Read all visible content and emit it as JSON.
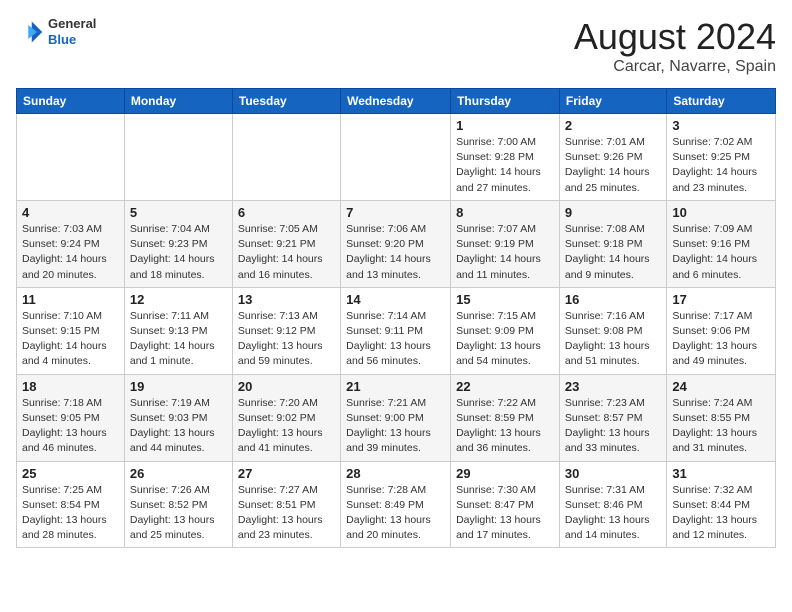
{
  "header": {
    "logo_line1": "General",
    "logo_line2": "Blue",
    "month_year": "August 2024",
    "location": "Carcar, Navarre, Spain"
  },
  "weekdays": [
    "Sunday",
    "Monday",
    "Tuesday",
    "Wednesday",
    "Thursday",
    "Friday",
    "Saturday"
  ],
  "weeks": [
    [
      {
        "day": "",
        "detail": ""
      },
      {
        "day": "",
        "detail": ""
      },
      {
        "day": "",
        "detail": ""
      },
      {
        "day": "",
        "detail": ""
      },
      {
        "day": "1",
        "detail": "Sunrise: 7:00 AM\nSunset: 9:28 PM\nDaylight: 14 hours\nand 27 minutes."
      },
      {
        "day": "2",
        "detail": "Sunrise: 7:01 AM\nSunset: 9:26 PM\nDaylight: 14 hours\nand 25 minutes."
      },
      {
        "day": "3",
        "detail": "Sunrise: 7:02 AM\nSunset: 9:25 PM\nDaylight: 14 hours\nand 23 minutes."
      }
    ],
    [
      {
        "day": "4",
        "detail": "Sunrise: 7:03 AM\nSunset: 9:24 PM\nDaylight: 14 hours\nand 20 minutes."
      },
      {
        "day": "5",
        "detail": "Sunrise: 7:04 AM\nSunset: 9:23 PM\nDaylight: 14 hours\nand 18 minutes."
      },
      {
        "day": "6",
        "detail": "Sunrise: 7:05 AM\nSunset: 9:21 PM\nDaylight: 14 hours\nand 16 minutes."
      },
      {
        "day": "7",
        "detail": "Sunrise: 7:06 AM\nSunset: 9:20 PM\nDaylight: 14 hours\nand 13 minutes."
      },
      {
        "day": "8",
        "detail": "Sunrise: 7:07 AM\nSunset: 9:19 PM\nDaylight: 14 hours\nand 11 minutes."
      },
      {
        "day": "9",
        "detail": "Sunrise: 7:08 AM\nSunset: 9:18 PM\nDaylight: 14 hours\nand 9 minutes."
      },
      {
        "day": "10",
        "detail": "Sunrise: 7:09 AM\nSunset: 9:16 PM\nDaylight: 14 hours\nand 6 minutes."
      }
    ],
    [
      {
        "day": "11",
        "detail": "Sunrise: 7:10 AM\nSunset: 9:15 PM\nDaylight: 14 hours\nand 4 minutes."
      },
      {
        "day": "12",
        "detail": "Sunrise: 7:11 AM\nSunset: 9:13 PM\nDaylight: 14 hours\nand 1 minute."
      },
      {
        "day": "13",
        "detail": "Sunrise: 7:13 AM\nSunset: 9:12 PM\nDaylight: 13 hours\nand 59 minutes."
      },
      {
        "day": "14",
        "detail": "Sunrise: 7:14 AM\nSunset: 9:11 PM\nDaylight: 13 hours\nand 56 minutes."
      },
      {
        "day": "15",
        "detail": "Sunrise: 7:15 AM\nSunset: 9:09 PM\nDaylight: 13 hours\nand 54 minutes."
      },
      {
        "day": "16",
        "detail": "Sunrise: 7:16 AM\nSunset: 9:08 PM\nDaylight: 13 hours\nand 51 minutes."
      },
      {
        "day": "17",
        "detail": "Sunrise: 7:17 AM\nSunset: 9:06 PM\nDaylight: 13 hours\nand 49 minutes."
      }
    ],
    [
      {
        "day": "18",
        "detail": "Sunrise: 7:18 AM\nSunset: 9:05 PM\nDaylight: 13 hours\nand 46 minutes."
      },
      {
        "day": "19",
        "detail": "Sunrise: 7:19 AM\nSunset: 9:03 PM\nDaylight: 13 hours\nand 44 minutes."
      },
      {
        "day": "20",
        "detail": "Sunrise: 7:20 AM\nSunset: 9:02 PM\nDaylight: 13 hours\nand 41 minutes."
      },
      {
        "day": "21",
        "detail": "Sunrise: 7:21 AM\nSunset: 9:00 PM\nDaylight: 13 hours\nand 39 minutes."
      },
      {
        "day": "22",
        "detail": "Sunrise: 7:22 AM\nSunset: 8:59 PM\nDaylight: 13 hours\nand 36 minutes."
      },
      {
        "day": "23",
        "detail": "Sunrise: 7:23 AM\nSunset: 8:57 PM\nDaylight: 13 hours\nand 33 minutes."
      },
      {
        "day": "24",
        "detail": "Sunrise: 7:24 AM\nSunset: 8:55 PM\nDaylight: 13 hours\nand 31 minutes."
      }
    ],
    [
      {
        "day": "25",
        "detail": "Sunrise: 7:25 AM\nSunset: 8:54 PM\nDaylight: 13 hours\nand 28 minutes."
      },
      {
        "day": "26",
        "detail": "Sunrise: 7:26 AM\nSunset: 8:52 PM\nDaylight: 13 hours\nand 25 minutes."
      },
      {
        "day": "27",
        "detail": "Sunrise: 7:27 AM\nSunset: 8:51 PM\nDaylight: 13 hours\nand 23 minutes."
      },
      {
        "day": "28",
        "detail": "Sunrise: 7:28 AM\nSunset: 8:49 PM\nDaylight: 13 hours\nand 20 minutes."
      },
      {
        "day": "29",
        "detail": "Sunrise: 7:30 AM\nSunset: 8:47 PM\nDaylight: 13 hours\nand 17 minutes."
      },
      {
        "day": "30",
        "detail": "Sunrise: 7:31 AM\nSunset: 8:46 PM\nDaylight: 13 hours\nand 14 minutes."
      },
      {
        "day": "31",
        "detail": "Sunrise: 7:32 AM\nSunset: 8:44 PM\nDaylight: 13 hours\nand 12 minutes."
      }
    ]
  ]
}
